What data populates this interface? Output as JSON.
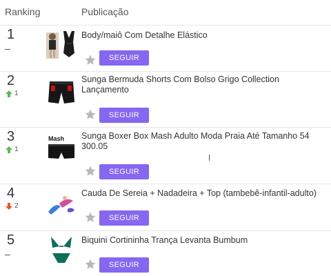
{
  "header": {
    "ranking_label": "Ranking",
    "publication_label": "Publicação"
  },
  "follow_label": "SEGUIR",
  "colors": {
    "accent": "#8567f0",
    "trend_up": "#5cb85c",
    "trend_down": "#e05a2b",
    "star": "#b8b8b8"
  },
  "items": [
    {
      "rank": "1",
      "trend": "none",
      "change": "",
      "title": "Body/maiô Com Detalhe Elástico",
      "thumbnail": "black-swimsuit-image"
    },
    {
      "rank": "2",
      "trend": "up",
      "change": "1",
      "title": "Sunga Bermuda Shorts Com Bolso Grigo Collection Lançamento",
      "thumbnail": "swim-shorts-image"
    },
    {
      "rank": "3",
      "trend": "up",
      "change": "1",
      "title": "Sunga Boxer Box Mash Adulto Moda Praia Até Tamanho 54 300.05",
      "thumbnail": "boxer-swim-trunks-image",
      "thumb_text": "Mash"
    },
    {
      "rank": "4",
      "trend": "down",
      "change": "2",
      "title": "Cauda De Sereia + Nadadeira + Top (tambebê-infantil-adulto)",
      "thumbnail": "mermaid-tail-image"
    },
    {
      "rank": "5",
      "trend": "none",
      "change": "",
      "title": "Biquini Cortininha Trança Levanta Bumbum",
      "thumbnail": "green-bikini-image"
    }
  ]
}
